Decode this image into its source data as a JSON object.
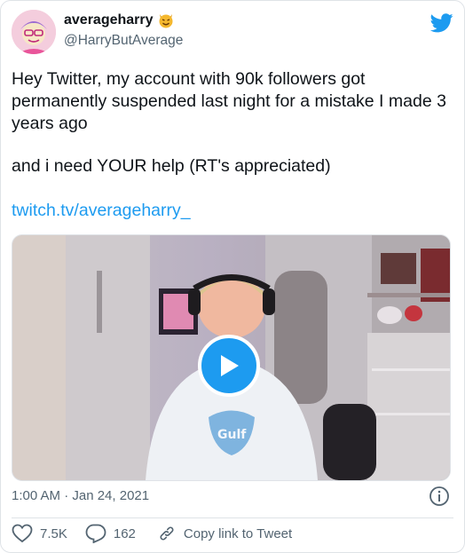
{
  "user": {
    "display_name": "averageharry",
    "handle": "@HarryButAverage",
    "emoji": "smiling-face-with-horns-emoji"
  },
  "tweet": {
    "line1": "Hey Twitter, my account with 90k followers got permanently suspended last night for a mistake I made 3 years ago",
    "line2": "and i need YOUR help (RT's appreciated)",
    "link": "twitch.tv/averageharry_"
  },
  "media": {
    "type": "video",
    "play_icon": "play-icon"
  },
  "meta": {
    "timestamp": "1:00 AM · Jan 24, 2021"
  },
  "actions": {
    "likes": "7.5K",
    "replies": "162",
    "copy_link": "Copy link to Tweet"
  },
  "colors": {
    "accent": "#1d9bf0",
    "text": "#0f1419",
    "muted": "#536471",
    "border": "#dfe3e7"
  }
}
